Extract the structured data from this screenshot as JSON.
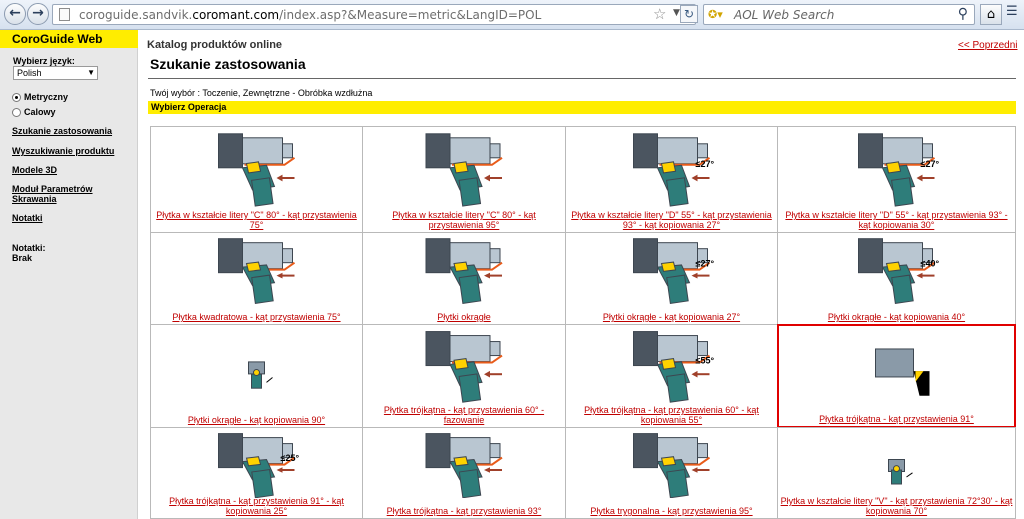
{
  "browser": {
    "url_prefix": "coroguide.sandvik.",
    "url_domain": "coromant.com",
    "url_path": "/index.asp?&Measure=metric&LangID=POL",
    "search_placeholder": "AOL Web Search",
    "back_icon": "back-arrow-icon",
    "forward_icon": "forward-arrow-icon"
  },
  "sidebar": {
    "brand": "CoroGuide Web",
    "language_label": "Wybierz język:",
    "language_value": "Polish",
    "radios": [
      {
        "label": "Metryczny",
        "checked": true
      },
      {
        "label": "Calowy",
        "checked": false
      }
    ],
    "links": [
      {
        "label": "Szukanie zastosowania"
      },
      {
        "label": "Wyszukiwanie produktu"
      },
      {
        "label": "Modele 3D"
      },
      {
        "label": "Moduł Parametrów Skrawania"
      },
      {
        "label": "Notatki"
      }
    ],
    "notes_label": "Notatki:",
    "notes_value": "Brak"
  },
  "main": {
    "catalog_title": "Katalog produktów online",
    "back_link": "<< Poprzedni",
    "page_title": "Szukanie zastosowania",
    "choice": "Twój wybór : Toczenie, Zewnętrzne - Obróbka wzdłużna",
    "operation_bar": "Wybierz Operacja",
    "accent_color": "#ffed00",
    "link_color": "#c00000",
    "selected_border_color": "#e00000",
    "cells": [
      {
        "caption": "Płytka w kształcie litery \"C\" 80° - kąt przystawienia 75°",
        "angle": "",
        "selected": false
      },
      {
        "caption": "Płytka w kształcie litery \"C\" 80° - kąt przystawienia 95°",
        "angle": "",
        "selected": false
      },
      {
        "caption": "Płytka w kształcie litery \"D\" 55° - kąt przystawienia 93° - kąt kopiowania 27°",
        "angle": "≤27°",
        "selected": false
      },
      {
        "caption": "Płytka w kształcie litery \"D\" 55° - kąt przystawienia 93° - kąt kopiowania 30°",
        "angle": "≤27°",
        "selected": false
      },
      {
        "caption": "Płytka kwadratowa - kąt przystawienia 75°",
        "angle": "",
        "selected": false
      },
      {
        "caption": "Płytki okrągłe",
        "angle": "",
        "selected": false
      },
      {
        "caption": "Płytki okrągłe - kąt kopiowania 27°",
        "angle": "≤27°",
        "selected": false
      },
      {
        "caption": "Płytki okrągłe - kąt kopiowania 40°",
        "angle": "≤40°",
        "selected": false
      },
      {
        "caption": "Płytki okrągłe - kąt kopiowania 90°",
        "angle": "",
        "selected": false
      },
      {
        "caption": "Płytka trójkątna - kąt przystawienia 60° - fazowanie",
        "angle": "",
        "selected": false
      },
      {
        "caption": "Płytka trójkątna - kąt przystawienia 60° - kąt kopiowania 55°",
        "angle": "≤55°",
        "selected": false
      },
      {
        "caption": "Płytka trójkątna - kąt przystawienia 91°",
        "angle": "",
        "selected": true
      },
      {
        "caption": "Płytka trójkątna - kąt przystawienia 91° - kąt kopiowania 25°",
        "angle": "≤25°",
        "selected": false
      },
      {
        "caption": "Płytka trójkątna - kąt przystawienia 93°",
        "angle": "",
        "selected": false
      },
      {
        "caption": "Płytka trygonalna - kąt przystawienia 95°",
        "angle": "",
        "selected": false
      },
      {
        "caption": "Płytka w kształcie litery \"V\" - kąt przystawienia 72°30' - kąt kopiowania 70°",
        "angle": "",
        "selected": false
      }
    ]
  }
}
